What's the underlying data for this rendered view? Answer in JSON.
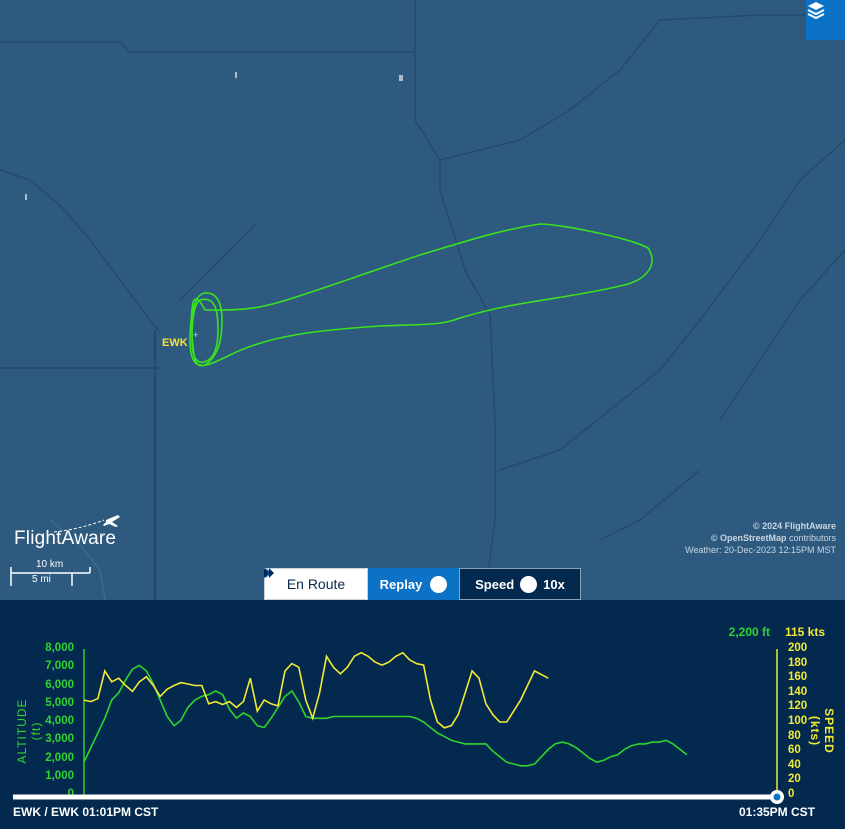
{
  "map": {
    "airport_label": "EWK",
    "brand": "FlightAware",
    "scale": {
      "km": "10 km",
      "mi": "5 mi"
    },
    "attribution": {
      "line1": "© 2024 FlightAware",
      "line2_bold": "© OpenStreetMap",
      "line2_rest": " contributors",
      "weather": "Weather: 20-Dec-2023 12:15PM MST"
    },
    "layers_icon": "layers-icon",
    "colors": {
      "map_bg": "#2d5a7e",
      "track": "#39e11f",
      "airport": "#f7e23b"
    }
  },
  "controls": {
    "en_route": "En Route",
    "replay": "Replay",
    "speed_label": "Speed",
    "speed_value": "10x"
  },
  "graph": {
    "current_altitude": "2,200 ft",
    "current_speed": "115 kts",
    "altitude_axis_title": "ALTITUDE (ft)",
    "speed_axis_title": "SPEED (kts)",
    "altitude_ticks": [
      "8,000",
      "7,000",
      "6,000",
      "5,000",
      "4,000",
      "3,000",
      "2,000",
      "1,000",
      "0"
    ],
    "speed_ticks": [
      "200",
      "180",
      "160",
      "140",
      "120",
      "100",
      "80",
      "60",
      "40",
      "20",
      "0"
    ],
    "start_label": "EWK / EWK 01:01PM CST",
    "end_label": "01:35PM CST",
    "colors": {
      "altitude": "#2ed52e",
      "speed": "#f2ea34"
    }
  },
  "chart_data": {
    "type": "line",
    "x": [
      0,
      1,
      2,
      3,
      4,
      5,
      6,
      7,
      8,
      9,
      10,
      11,
      12,
      13,
      14,
      15,
      16,
      17,
      18,
      19,
      20,
      21,
      22,
      23,
      24,
      25,
      26,
      27,
      28,
      29,
      30,
      31,
      32,
      33,
      34,
      35,
      36,
      37,
      38,
      39,
      40,
      41,
      42,
      43,
      44,
      45,
      46,
      47,
      48,
      49,
      50,
      51,
      52,
      53,
      54,
      55,
      56,
      57,
      58,
      59,
      60,
      61,
      62,
      63,
      64,
      65,
      66,
      67,
      68,
      69,
      70,
      71,
      72,
      73,
      74,
      75,
      76,
      77,
      78,
      79,
      80,
      81,
      82,
      83,
      84,
      85,
      86,
      87,
      88,
      89,
      90,
      91,
      92,
      93,
      94,
      95,
      96,
      97,
      98,
      99,
      100
    ],
    "series": [
      {
        "name": "ALTITUDE (ft)",
        "axis": "left",
        "values": [
          1800,
          2600,
          3400,
          4200,
          5200,
          5600,
          6300,
          6900,
          7100,
          6800,
          6100,
          5200,
          4300,
          3800,
          4100,
          4800,
          5200,
          5400,
          5500,
          5700,
          5500,
          4700,
          4200,
          4500,
          4300,
          3800,
          3700,
          4200,
          4800,
          5400,
          5700,
          5100,
          4300,
          4200,
          4200,
          4200,
          4300,
          4300,
          4300,
          4300,
          4300,
          4300,
          4300,
          4300,
          4300,
          4300,
          4300,
          4300,
          4200,
          4000,
          3700,
          3400,
          3200,
          3000,
          2900,
          2800,
          2800,
          2800,
          2800,
          2400,
          2100,
          1800,
          1700,
          1600,
          1600,
          1700,
          2100,
          2500,
          2800,
          2900,
          2800,
          2600,
          2300,
          2000,
          1800,
          1900,
          2100,
          2200,
          2500,
          2700,
          2800,
          2800,
          2900,
          2900,
          3000,
          2800,
          2500,
          2200,
          2200,
          2200,
          2200,
          2200,
          2200,
          2200,
          2200,
          2200,
          2200,
          2200,
          2200,
          2200,
          2200
        ],
        "x_max_index": 87
      },
      {
        "name": "SPEED (kts)",
        "axis": "right",
        "values": [
          130,
          128,
          132,
          170,
          155,
          160,
          150,
          142,
          155,
          162,
          150,
          135,
          145,
          150,
          154,
          152,
          150,
          150,
          125,
          128,
          124,
          128,
          120,
          128,
          160,
          115,
          130,
          125,
          122,
          170,
          180,
          175,
          130,
          105,
          140,
          190,
          175,
          166,
          175,
          190,
          195,
          190,
          182,
          178,
          182,
          190,
          195,
          185,
          180,
          178,
          130,
          100,
          92,
          95,
          110,
          140,
          170,
          160,
          125,
          110,
          100,
          100,
          115,
          130,
          150,
          170,
          165,
          160,
          120,
          117,
          115,
          115,
          115,
          115,
          115,
          115,
          115,
          115,
          115,
          115,
          115,
          115,
          115,
          115,
          115,
          115,
          115,
          115,
          115,
          115,
          115,
          115,
          115,
          115,
          115,
          115,
          115,
          115,
          115,
          115,
          115
        ],
        "x_max_index": 67
      }
    ],
    "ylim_left": [
      0,
      8000
    ],
    "ylim_right": [
      0,
      200
    ],
    "xlabel_start": "EWK / EWK 01:01PM CST",
    "xlabel_end": "01:35PM CST"
  }
}
